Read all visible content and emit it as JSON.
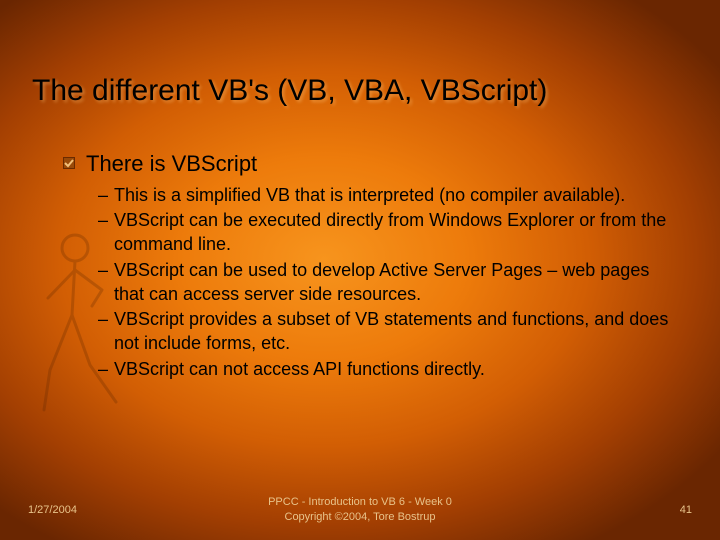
{
  "title": "The different VB's (VB, VBA, VBScript)",
  "level1": "There is VBScript",
  "sub": [
    "This is a simplified VB that is interpreted (no compiler available).",
    "VBScript can be executed directly from Windows Explorer or from the command line.",
    "VBScript can be used to develop Active Server Pages – web pages that can access server side resources.",
    "VBScript provides a subset of VB statements and functions, and does not include forms, etc.",
    "VBScript can not access API functions directly."
  ],
  "footer": {
    "date": "1/27/2004",
    "center1": "PPCC - Introduction to VB 6 - Week 0",
    "center2": "Copyright ©2004, Tore Bostrup",
    "page": "41"
  }
}
